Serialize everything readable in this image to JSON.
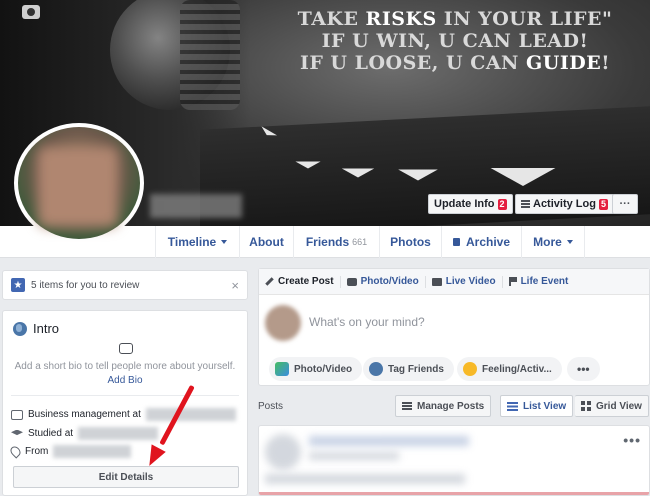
{
  "cover": {
    "quote_line1_a": "TAKE ",
    "quote_line1_b": "RISKS",
    "quote_line1_c": " IN YOUR LIFE\"",
    "quote_line2": "IF U WIN, U CAN LEAD!",
    "quote_line3_a": "IF U LOOSE, U CAN ",
    "quote_line3_b": "GUIDE",
    "quote_line3_c": "!",
    "update_info_label": "Update Info",
    "update_info_badge": "2",
    "activity_log_label": "Activity Log",
    "activity_log_badge": "5",
    "more_dots": "···"
  },
  "nav": {
    "timeline": "Timeline",
    "about": "About",
    "friends": "Friends",
    "friends_count": "661",
    "photos": "Photos",
    "archive": "Archive",
    "more": "More"
  },
  "review": {
    "text": "5 items for you to review",
    "close": "×"
  },
  "intro": {
    "title": "Intro",
    "bio_help": "Add a short bio to tell people more about yourself.",
    "add_bio": "Add Bio",
    "work": "Business management at",
    "study": "Studied at",
    "from": "From",
    "edit_details": "Edit Details"
  },
  "composer": {
    "tabs": {
      "create_post": "Create Post",
      "photo_video": "Photo/Video",
      "live_video": "Live Video",
      "life_event": "Life Event"
    },
    "placeholder": "What's on your mind?",
    "pills": {
      "photo_video": "Photo/Video",
      "tag_friends": "Tag Friends",
      "feeling": "Feeling/Activ...",
      "more": "•••"
    }
  },
  "posts": {
    "label": "Posts",
    "manage_posts": "Manage Posts",
    "list_view": "List View",
    "grid_view": "Grid View",
    "post_menu": "•••"
  },
  "colors": {
    "link_blue": "#365899",
    "badge_red": "#e41e3f",
    "arrow_red": "#e0141e",
    "page_bg": "#e9ebee"
  }
}
